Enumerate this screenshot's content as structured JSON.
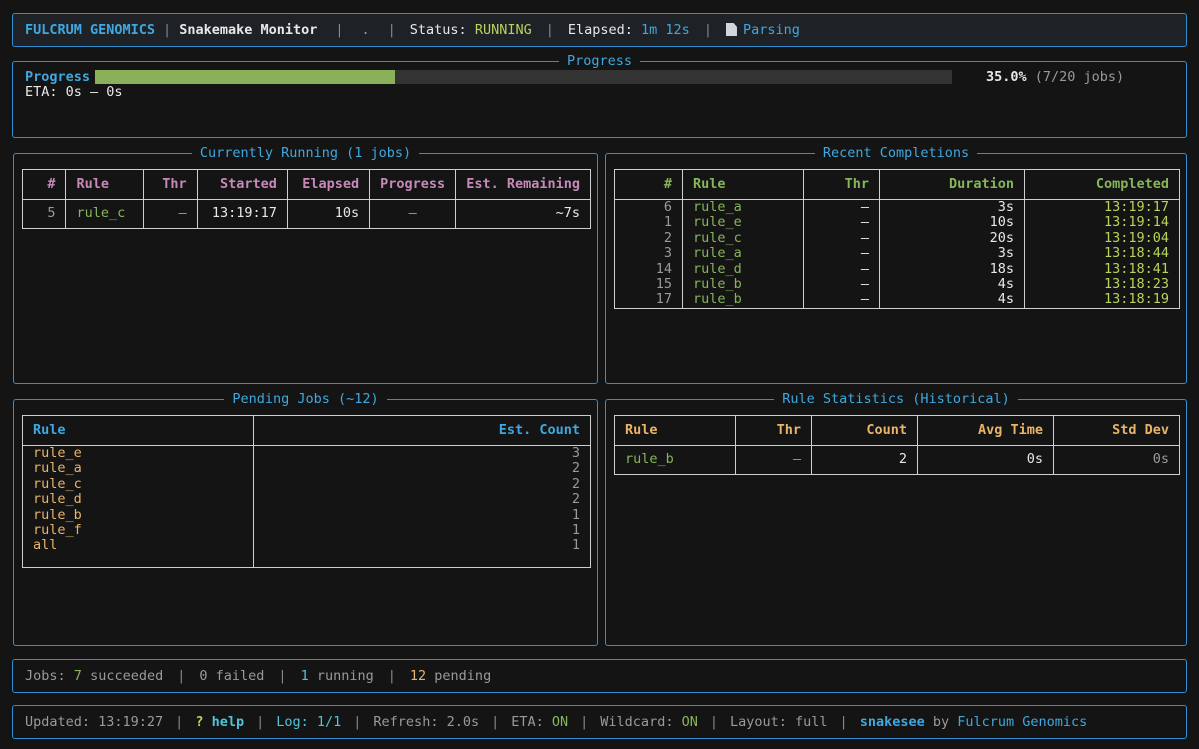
{
  "header": {
    "brand": "FULCRUM GENOMICS",
    "app_title": "Snakemake Monitor",
    "dir": ".",
    "status_label": "Status:",
    "status_value": "RUNNING",
    "elapsed_label": "Elapsed:",
    "elapsed_value": "1m 12s",
    "parse_icon": "document-icon",
    "parse_label": "Parsing"
  },
  "progress": {
    "title": "Progress",
    "label": "Progress",
    "fraction": 0.35,
    "percent": "35.0%",
    "jobs": "(7/20 jobs)",
    "eta": "ETA: 0s – 0s"
  },
  "running": {
    "title": "Currently Running (1 jobs)",
    "columns": [
      "#",
      "Rule",
      "Thr",
      "Started",
      "Elapsed",
      "Progress",
      "Est. Remaining"
    ],
    "rows": [
      {
        "num": "5",
        "rule": "rule_c",
        "thr": "–",
        "started": "13:19:17",
        "elapsed": "10s",
        "progress": "–",
        "remaining": "~7s"
      }
    ]
  },
  "completions": {
    "title": "Recent Completions",
    "columns": [
      "#",
      "Rule",
      "Thr",
      "Duration",
      "Completed"
    ],
    "num": [
      "6",
      "1",
      "2",
      "3",
      "14",
      "15",
      "17"
    ],
    "rule": [
      "rule_a",
      "rule_e",
      "rule_c",
      "rule_a",
      "rule_d",
      "rule_b",
      "rule_b"
    ],
    "thr": [
      "–",
      "–",
      "–",
      "–",
      "–",
      "–",
      "–"
    ],
    "duration": [
      "3s",
      "10s",
      "20s",
      "3s",
      "18s",
      "4s",
      "4s"
    ],
    "completed": [
      "13:19:17",
      "13:19:14",
      "13:19:04",
      "13:18:44",
      "13:18:41",
      "13:18:23",
      "13:18:19"
    ]
  },
  "pending": {
    "title": "Pending Jobs (~12)",
    "columns": [
      "Rule",
      "Est. Count"
    ],
    "rule": [
      "rule_e",
      "rule_a",
      "rule_c",
      "rule_d",
      "rule_b",
      "rule_f",
      "all"
    ],
    "count": [
      "3",
      "2",
      "2",
      "2",
      "1",
      "1",
      "1"
    ]
  },
  "stats": {
    "title": "Rule Statistics (Historical)",
    "columns": [
      "Rule",
      "Thr",
      "Count",
      "Avg Time",
      "Std Dev"
    ],
    "rows": [
      {
        "rule": "rule_b",
        "thr": "–",
        "count": "2",
        "avg": "0s",
        "std": "0s"
      }
    ]
  },
  "summary": {
    "jobs_label": "Jobs:",
    "succeeded_count": "7",
    "succeeded_label": "succeeded",
    "failed_count": "0",
    "failed_label": "failed",
    "running_count": "1",
    "running_label": "running",
    "pending_count": "12",
    "pending_label": "pending"
  },
  "footer": {
    "updated": "Updated: 13:19:27",
    "help_key": "?",
    "help_label": "help",
    "log": "Log: 1/1",
    "refresh": "Refresh: 2.0s",
    "eta_label": "ETA:",
    "eta_value": "ON",
    "wildcard_label": "Wildcard:",
    "wildcard_value": "ON",
    "layout": "Layout: full",
    "app_name": "snakesee",
    "by": "by",
    "company": "Fulcrum Genomics"
  }
}
